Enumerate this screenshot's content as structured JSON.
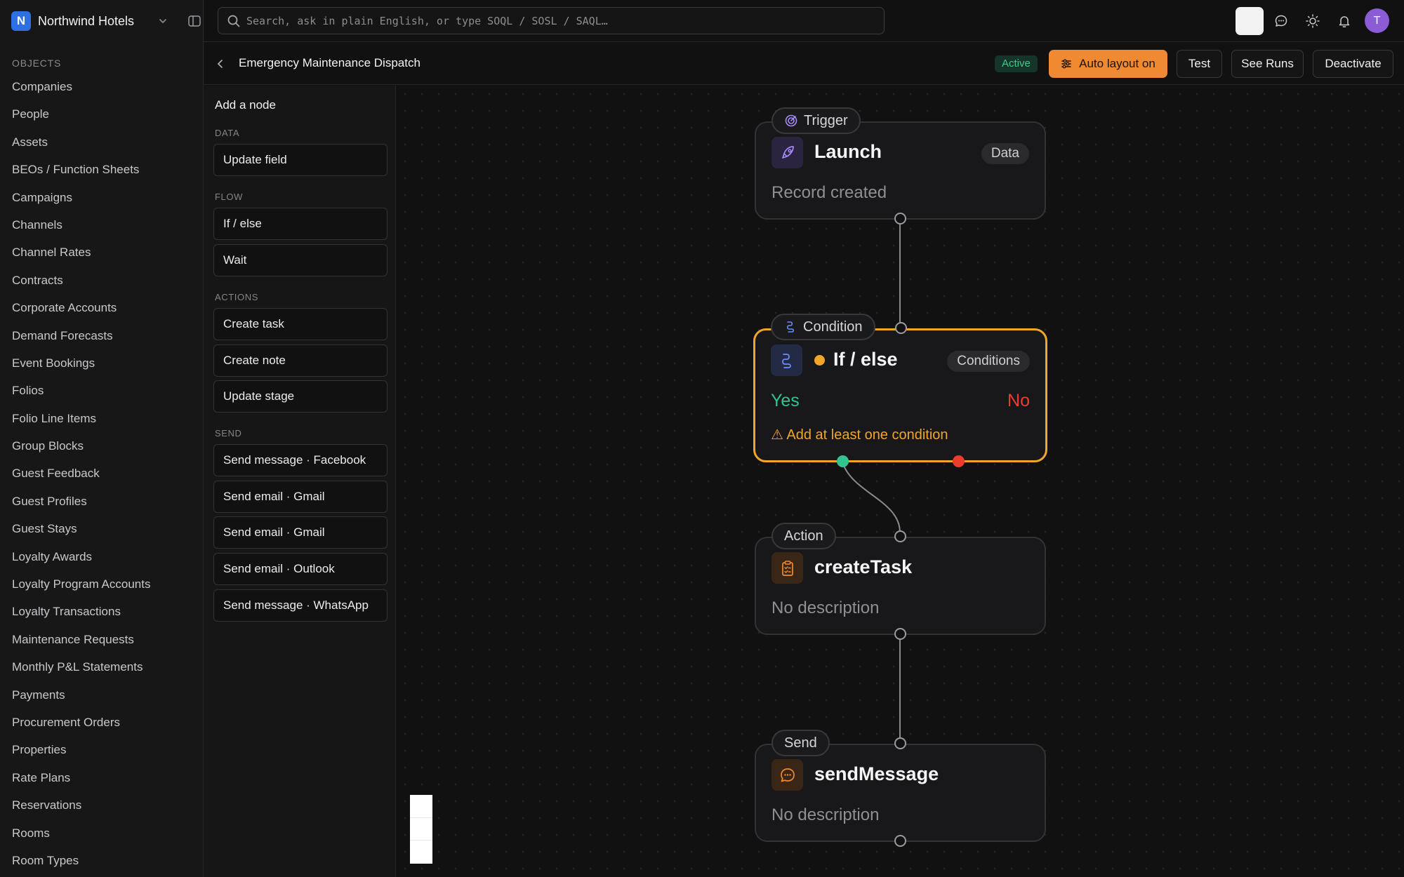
{
  "workspace": {
    "initial": "N",
    "name": "Northwind Hotels"
  },
  "objects": {
    "heading": "OBJECTS",
    "items": [
      {
        "label": "Companies"
      },
      {
        "label": "People"
      },
      {
        "label": "Assets"
      },
      {
        "label": "BEOs / Function Sheets"
      },
      {
        "label": "Campaigns"
      },
      {
        "label": "Channels"
      },
      {
        "label": "Channel Rates"
      },
      {
        "label": "Contracts"
      },
      {
        "label": "Corporate Accounts"
      },
      {
        "label": "Demand Forecasts"
      },
      {
        "label": "Event Bookings"
      },
      {
        "label": "Folios"
      },
      {
        "label": "Folio Line Items"
      },
      {
        "label": "Group Blocks"
      },
      {
        "label": "Guest Feedback"
      },
      {
        "label": "Guest Profiles"
      },
      {
        "label": "Guest Stays"
      },
      {
        "label": "Loyalty Awards"
      },
      {
        "label": "Loyalty Program Accounts"
      },
      {
        "label": "Loyalty Transactions"
      },
      {
        "label": "Maintenance Requests"
      },
      {
        "label": "Monthly P&L Statements"
      },
      {
        "label": "Payments"
      },
      {
        "label": "Procurement Orders"
      },
      {
        "label": "Properties"
      },
      {
        "label": "Rate Plans"
      },
      {
        "label": "Reservations"
      },
      {
        "label": "Rooms"
      },
      {
        "label": "Room Types"
      }
    ]
  },
  "search": {
    "placeholder": "Search, ask in plain English, or type SOQL / SOSL / SAQL…",
    "value": ""
  },
  "user": {
    "avatar_initial": "T"
  },
  "header": {
    "title": "Emergency Maintenance Dispatch",
    "status": "Active",
    "auto_layout_label": "Auto layout on",
    "test_label": "Test",
    "see_runs_label": "See Runs",
    "deactivate_label": "Deactivate"
  },
  "palette": {
    "title": "Add a node",
    "sections": {
      "data": "DATA",
      "flow": "FLOW",
      "actions": "ACTIONS",
      "send": "SEND"
    },
    "items": {
      "update_field": "Update field",
      "if_else": "If / else",
      "wait": "Wait",
      "create_task": "Create task",
      "create_note": "Create note",
      "update_stage": "Update stage",
      "send_facebook": "Send message · Facebook",
      "send_gmail_1": "Send email · Gmail",
      "send_gmail_2": "Send email · Gmail",
      "send_outlook": "Send email · Outlook",
      "send_whatsapp": "Send message · WhatsApp"
    }
  },
  "nodes": {
    "trigger": {
      "tag": "Trigger",
      "name": "Launch",
      "pill": "Data",
      "desc": "Record created"
    },
    "condition": {
      "tag": "Condition",
      "name": "If / else",
      "pill": "Conditions",
      "yes": "Yes",
      "no": "No",
      "warning": "⚠ Add at least one condition"
    },
    "action": {
      "tag": "Action",
      "name": "createTask",
      "desc": "No description"
    },
    "send": {
      "tag": "Send",
      "name": "sendMessage",
      "desc": "No description"
    }
  },
  "colors": {
    "accent": "#f08a32",
    "selected_border": "#f0a729",
    "yes": "#34c38f",
    "no": "#ef3b2d",
    "active_badge": "#3fcb8b",
    "trigger_icon": "#a78bfa",
    "condition_icon": "#6b8cff",
    "task_icon": "#f08a32"
  },
  "icons": {
    "workspace_chevron": "chevron-down-icon",
    "sidebar_toggle": "panel-icon",
    "search": "search-icon",
    "chat": "chat-icon",
    "theme": "sun-icon",
    "notifications": "bell-icon",
    "back": "chevron-left-icon",
    "auto_layout": "layout-icon"
  }
}
